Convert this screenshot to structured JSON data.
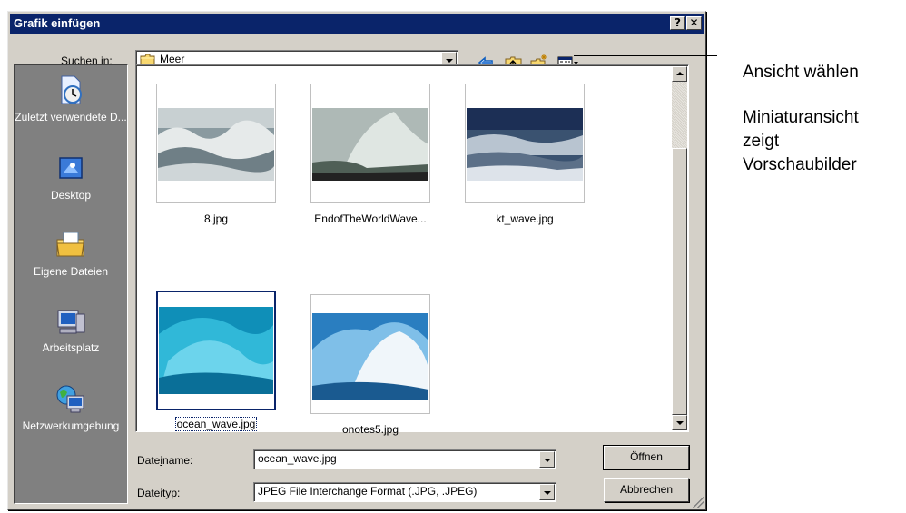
{
  "window": {
    "title": "Grafik einfügen",
    "help_label": "?",
    "close_label": "✕"
  },
  "toolbar": {
    "look_in_label": "Suchen in:",
    "look_in_value": "Meer",
    "icons": [
      "back-arrow-icon",
      "up-folder-icon",
      "new-folder-icon",
      "views-menu-icon"
    ]
  },
  "places": [
    {
      "label": "Zuletzt verwendete D...",
      "icon": "recent-documents-icon"
    },
    {
      "label": "Desktop",
      "icon": "desktop-icon"
    },
    {
      "label": "Eigene Dateien",
      "icon": "my-documents-icon"
    },
    {
      "label": "Arbeitsplatz",
      "icon": "my-computer-icon"
    },
    {
      "label": "Netzwerkumgebung",
      "icon": "network-icon"
    }
  ],
  "files": [
    {
      "name": "8.jpg"
    },
    {
      "name": "EndofTheWorldWave..."
    },
    {
      "name": "kt_wave.jpg"
    },
    {
      "name": "ocean_wave.jpg",
      "selected": true
    },
    {
      "name": "onotes5.jpg"
    }
  ],
  "bottom": {
    "filename_label": "Dateiname:",
    "filename_value": "ocean_wave.jpg",
    "filetype_label": "Dateityp:",
    "filetype_value": "JPEG File Interchange Format (.JPG, .JPEG)",
    "open_button": "Öffnen",
    "cancel_button": "Abbrechen"
  },
  "annotations": {
    "line1": "Ansicht wählen",
    "line2": "Miniaturansicht",
    "line3": "zeigt",
    "line4": "Vorschaubilder"
  },
  "colors": {
    "titlebar": "#0a246a",
    "face": "#d4d0c8",
    "places_bg": "#808080"
  }
}
